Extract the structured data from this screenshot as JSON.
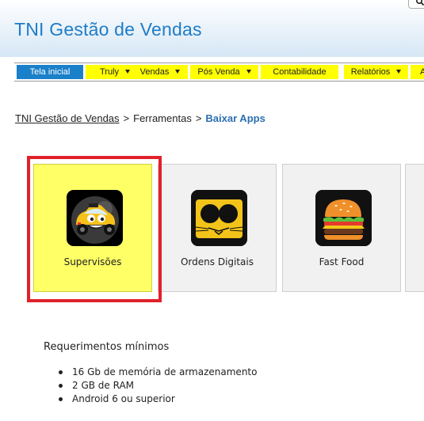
{
  "app": {
    "title": "TNI Gestão de Vendas"
  },
  "nav": {
    "items": [
      {
        "label": "Tela inicial",
        "dropdown": false,
        "active": true
      },
      {
        "label": "Truly",
        "dropdown": true
      },
      {
        "label": "Vendas",
        "dropdown": true
      },
      {
        "label": "Pós Venda",
        "dropdown": true
      },
      {
        "label": "Contabilidade",
        "dropdown": false
      },
      {
        "label": "Relatórios",
        "dropdown": true
      },
      {
        "label": "A",
        "dropdown": false
      }
    ]
  },
  "breadcrumb": {
    "root": "TNI Gestão de Vendas",
    "sep1": ">",
    "middle": "Ferramentas",
    "sep2": ">",
    "current": "Baixar Apps"
  },
  "apps": [
    {
      "label": "Supervisões",
      "icon": "taxi-car-icon",
      "selected": true
    },
    {
      "label": "Ordens Digitais",
      "icon": "cat-eyes-icon",
      "selected": false
    },
    {
      "label": "Fast Food",
      "icon": "burger-icon",
      "selected": false
    }
  ],
  "requirements": {
    "title": "Requerimentos mínimos",
    "items": [
      "16 Gb de memória de armazenamento",
      "2 GB de RAM",
      "Android 6 ou superior"
    ]
  },
  "colors": {
    "brand_blue": "#1f7cc6",
    "nav_yellow": "#ffff00",
    "home_blue": "#1a80c9",
    "selected_card": "#ffff66",
    "highlight_red": "#e0212a"
  }
}
